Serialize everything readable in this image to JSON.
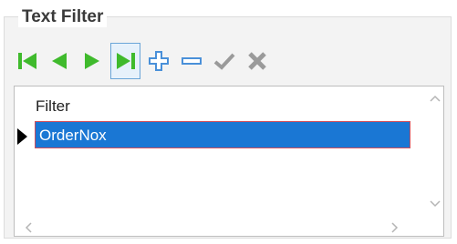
{
  "group": {
    "title": "Text Filter"
  },
  "grid": {
    "header": "Filter",
    "rows": [
      {
        "value": "OrderNox",
        "selected": true
      }
    ]
  },
  "toolbar": {
    "buttons": [
      {
        "name": "first-record",
        "icon": "first-icon"
      },
      {
        "name": "prev-record",
        "icon": "prev-icon"
      },
      {
        "name": "next-record",
        "icon": "next-icon"
      },
      {
        "name": "last-record",
        "icon": "last-icon",
        "active": true
      },
      {
        "name": "insert-record",
        "icon": "plus-icon"
      },
      {
        "name": "delete-record",
        "icon": "minus-icon"
      },
      {
        "name": "post-edit",
        "icon": "check-icon",
        "enabled": false
      },
      {
        "name": "cancel-edit",
        "icon": "x-icon",
        "enabled": false
      }
    ]
  },
  "colors": {
    "nav_green": "#3fba2c",
    "edit_blue": "#4a90d9",
    "disabled_gray": "#9a9a9a",
    "selection": "#1a77d4",
    "selection_border": "#d24f5a"
  }
}
